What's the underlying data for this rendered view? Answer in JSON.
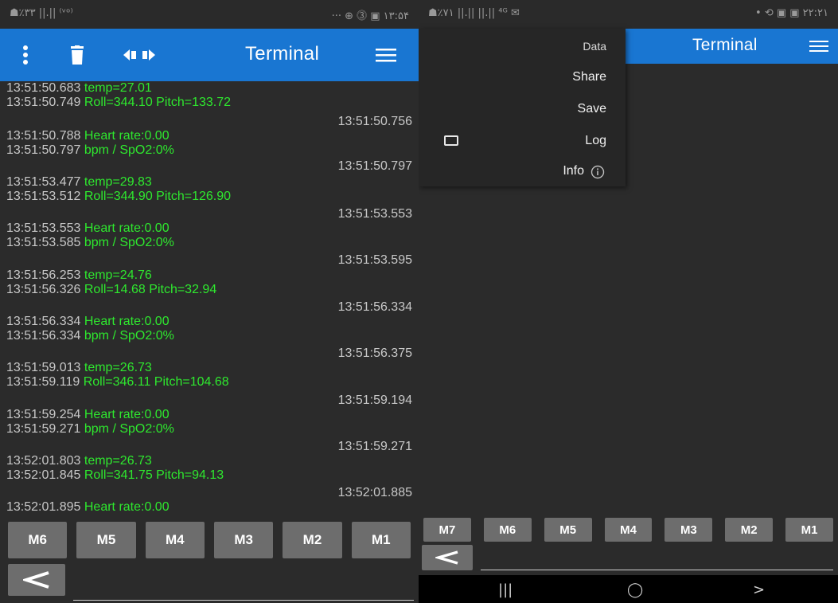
{
  "left": {
    "status": {
      "left": "☗٪۳۳ ||.|| ⁽ᵛᵒ⁾",
      "right": "··· ⊕ ⓷ ▣ ۱۳:۵۴"
    },
    "appbar": {
      "title": "Terminal"
    },
    "log": [
      {
        "ts": "13:51:50.683",
        "msg": "temp=27.01"
      },
      {
        "ts": "13:51:50.749",
        "msg": "Roll=344.10  Pitch=133.72"
      },
      {
        "ts": "13:51:50.788",
        "msg": "Heart rate:0.00"
      },
      {
        "ts": "13:51:50.797",
        "msg": "bpm / SpO2:0%"
      },
      {
        "ts": "13:51:53.477",
        "msg": "temp=29.83"
      },
      {
        "ts": "13:51:53.512",
        "msg": "Roll=344.90  Pitch=126.90"
      },
      {
        "ts": "13:51:53.553",
        "msg": "Heart rate:0.00"
      },
      {
        "ts": "13:51:53.585",
        "msg": "bpm / SpO2:0%"
      },
      {
        "ts": "13:51:56.253",
        "msg": "temp=24.76"
      },
      {
        "ts": "13:51:56.326",
        "msg": "Roll=14.68  Pitch=32.94"
      },
      {
        "ts": "13:51:56.334",
        "msg": "Heart rate:0.00"
      },
      {
        "ts": "13:51:56.334",
        "msg": "bpm / SpO2:0%"
      },
      {
        "ts": "13:51:59.013",
        "msg": "temp=26.73"
      },
      {
        "ts": "13:51:59.119",
        "msg": "Roll=346.11  Pitch=104.68"
      },
      {
        "ts": "13:51:59.254",
        "msg": "Heart rate:0.00"
      },
      {
        "ts": "13:51:59.271",
        "msg": "bpm / SpO2:0%"
      },
      {
        "ts": "13:52:01.803",
        "msg": "temp=26.73"
      },
      {
        "ts": "13:52:01.845",
        "msg": "Roll=341.75  Pitch=94.13"
      },
      {
        "ts": "13:52:01.895",
        "msg": "Heart rate:0.00"
      }
    ],
    "echoes": [
      "13:51:50.756",
      "13:51:50.797",
      "13:51:53.553",
      "13:51:53.595",
      "13:51:56.334",
      "13:51:56.375",
      "13:51:59.194",
      "13:51:59.271",
      "13:52:01.885"
    ],
    "macros": [
      "M6",
      "M5",
      "M4",
      "M3",
      "M2",
      "M1"
    ]
  },
  "right": {
    "status": {
      "left": "☗٪۷۱ ||.|| ||.|| ⁴ᴳ ✉",
      "right": "• ⟲ ▣ ▣ ۲۲:۲۱"
    },
    "appbar": {
      "title": "Terminal"
    },
    "menu": {
      "header": "Data",
      "share": "Share",
      "save": "Save",
      "log": "Log",
      "info": "Info"
    },
    "macros": [
      "M7",
      "M6",
      "M5",
      "M4",
      "M3",
      "M2",
      "M1"
    ],
    "navbar": {
      "recent": "|||",
      "home": "◯",
      "back": ">"
    }
  },
  "colors": {
    "appbar": "#1976d2",
    "background": "#2b2b2b",
    "message": "#2ee82e",
    "timestamp": "#c8c8c8",
    "button": "#6d6d6d"
  },
  "icons": [
    "more-vert-icon",
    "trash-icon",
    "bluetooth-connect-icon",
    "hamburger-menu-icon",
    "send-arrow-icon",
    "info-icon"
  ]
}
